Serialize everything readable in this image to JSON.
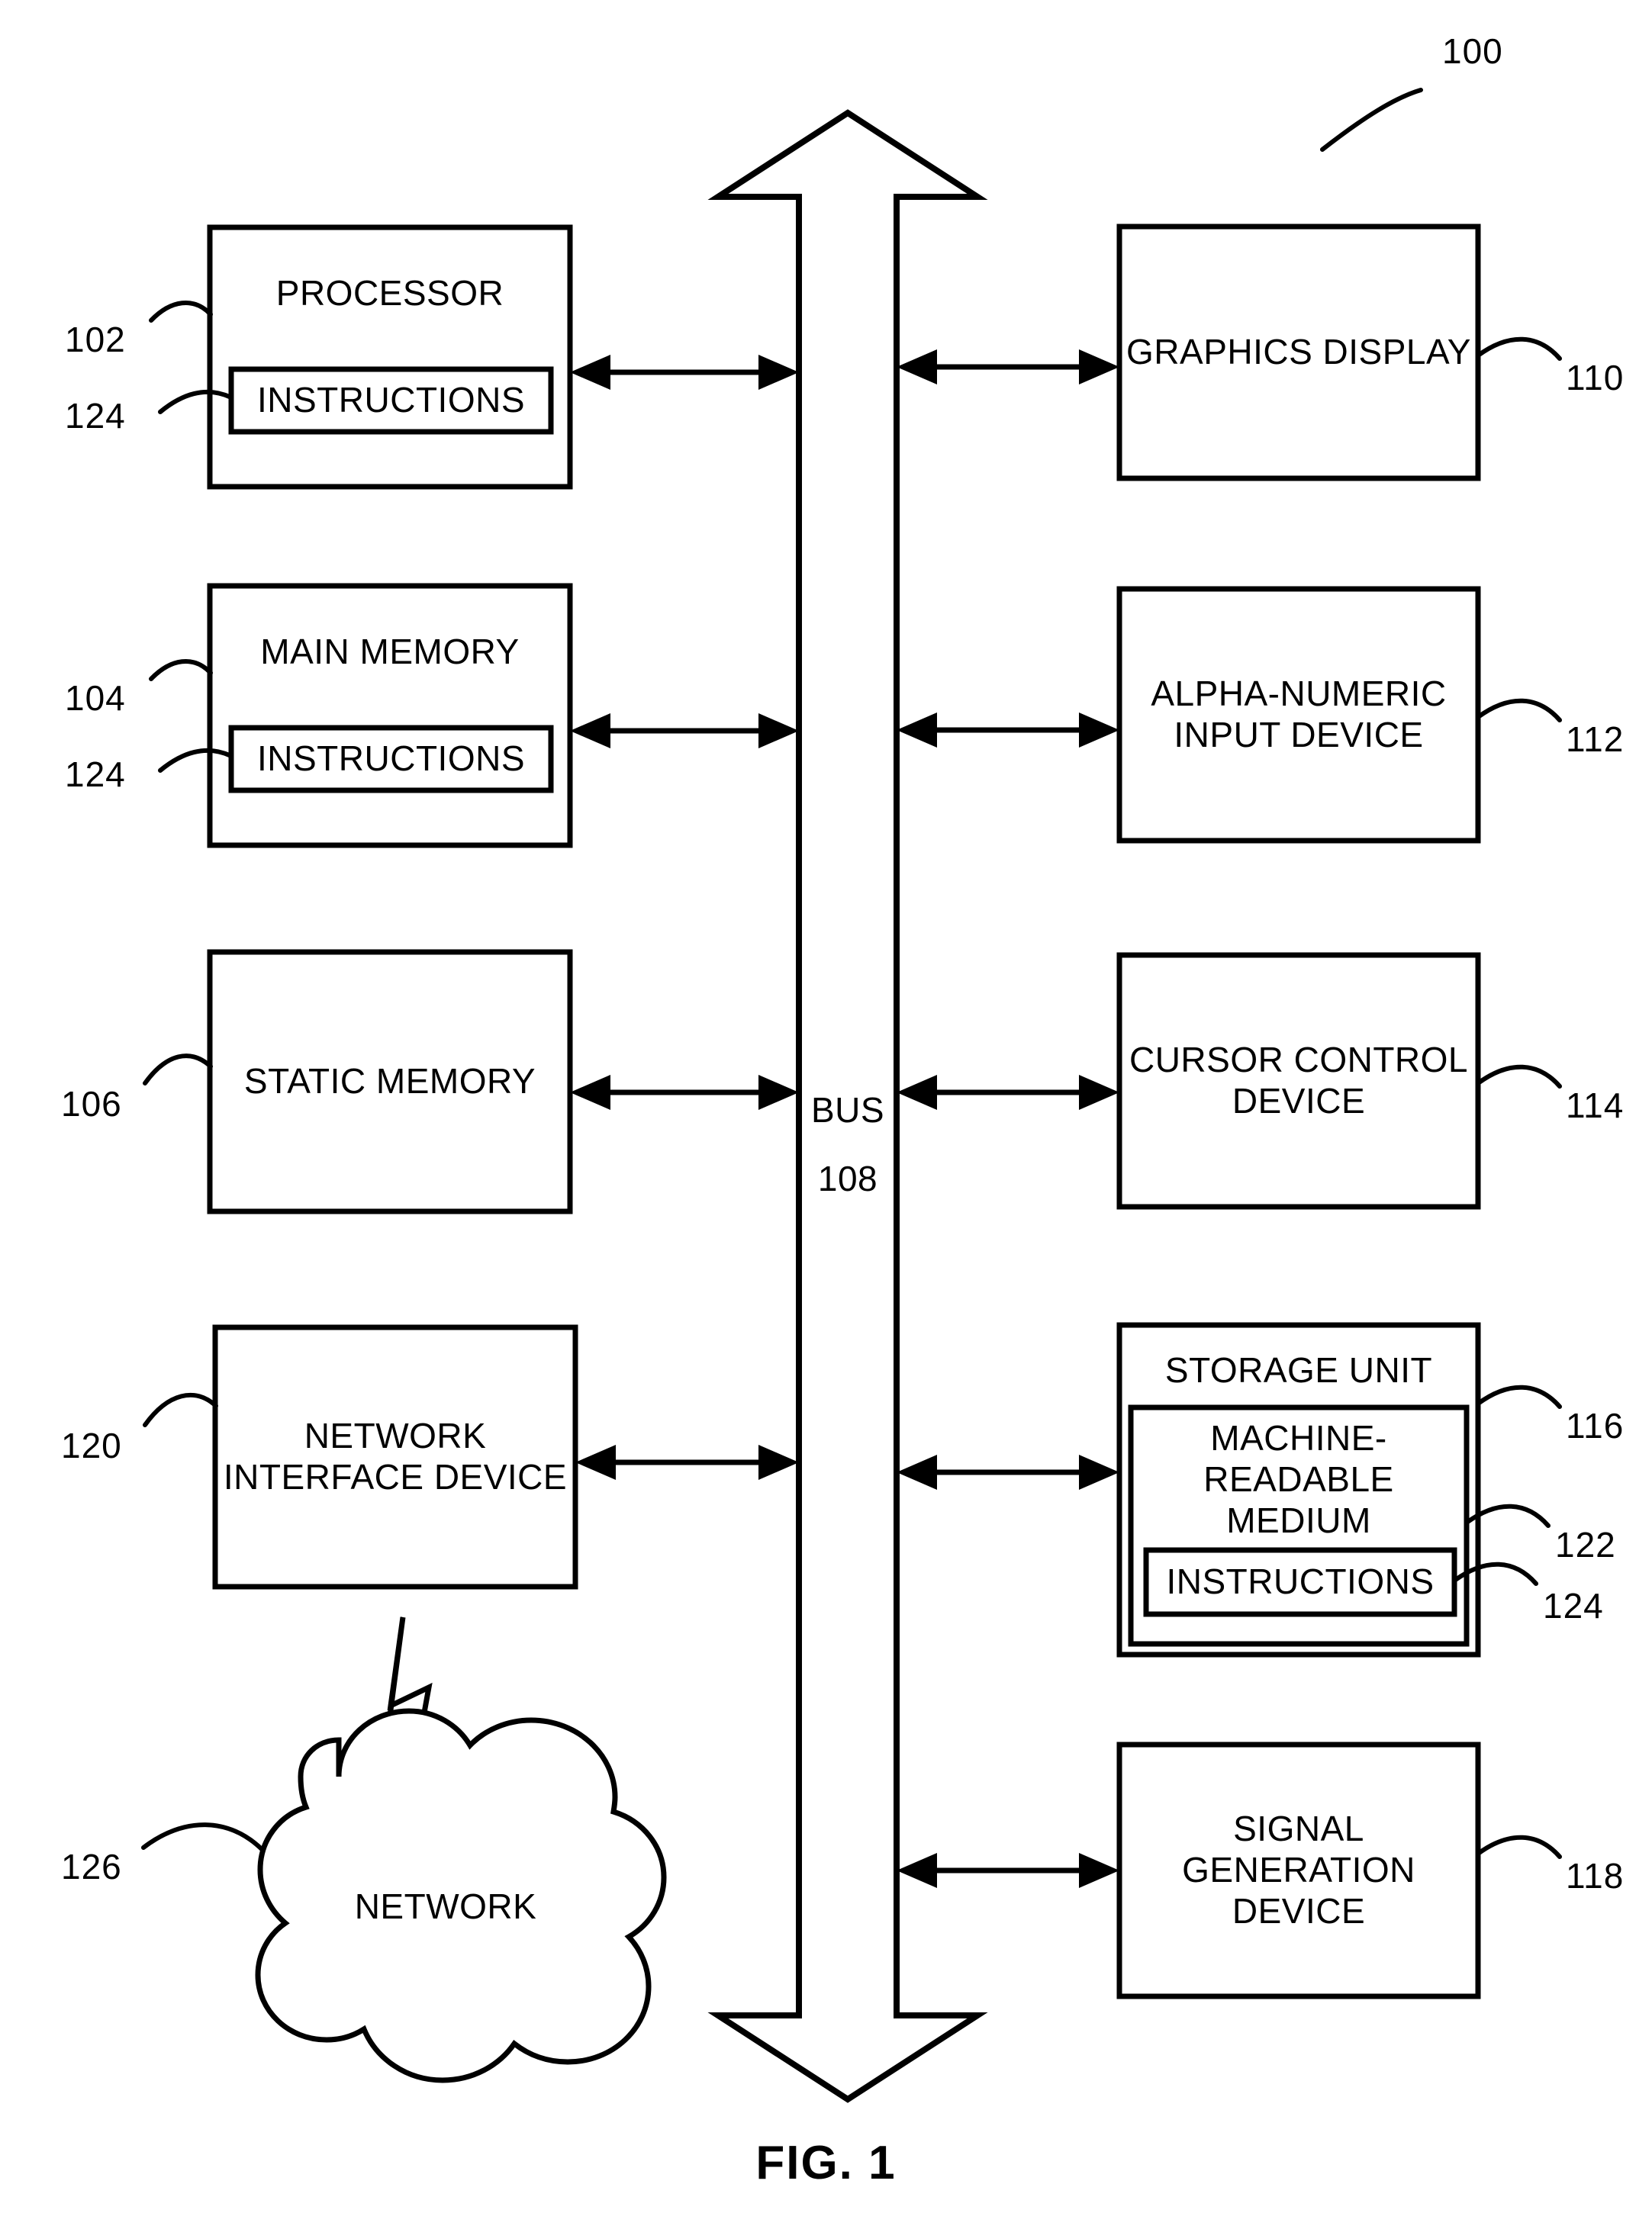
{
  "figure": {
    "caption": "FIG. 1",
    "system_ref": "100"
  },
  "bus": {
    "label": "BUS",
    "ref": "108"
  },
  "left_column": [
    {
      "name": "processor",
      "title": "PROCESSOR",
      "ref": "102",
      "inner": {
        "title": "INSTRUCTIONS",
        "ref": "124"
      }
    },
    {
      "name": "main-memory",
      "title": "MAIN MEMORY",
      "ref": "104",
      "inner": {
        "title": "INSTRUCTIONS",
        "ref": "124"
      }
    },
    {
      "name": "static-memory",
      "title": "STATIC\nMEMORY",
      "ref": "106",
      "inner": null
    },
    {
      "name": "network-interface-device",
      "title": "NETWORK\nINTERFACE\nDEVICE",
      "ref": "120",
      "inner": null
    }
  ],
  "right_column": [
    {
      "name": "graphics-display",
      "title": "GRAPHICS\nDISPLAY",
      "ref": "110"
    },
    {
      "name": "alpha-numeric-input-device",
      "title": "ALPHA-NUMERIC\nINPUT DEVICE",
      "ref": "112"
    },
    {
      "name": "cursor-control-device",
      "title": "CURSOR\nCONTROL\nDEVICE",
      "ref": "114"
    },
    {
      "name": "storage-unit",
      "title": "STORAGE UNIT",
      "ref": "116",
      "inner": {
        "title": "MACHINE-\nREADABLE\nMEDIUM",
        "ref": "122",
        "inner": {
          "title": "INSTRUCTIONS",
          "ref": "124"
        }
      }
    },
    {
      "name": "signal-generation-device",
      "title": "SIGNAL\nGENERATION\nDEVICE",
      "ref": "118"
    }
  ],
  "network": {
    "title": "NETWORK",
    "ref": "126"
  },
  "colors": {
    "stroke": "#000000",
    "background": "#ffffff"
  }
}
